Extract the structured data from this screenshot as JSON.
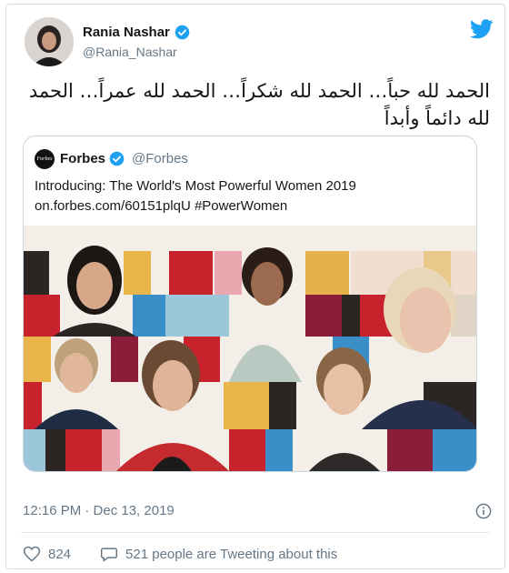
{
  "author": {
    "name": "Rania Nashar",
    "handle": "@Rania_Nashar"
  },
  "tweet": {
    "text": "الحمد لله حباً… الحمد لله شكراً… الحمد لله عمراً… الحمد لله دائماً وأبداً",
    "timestamp": "12:16 PM · Dec 13, 2019",
    "likes": "824",
    "replies_text": "521 people are Tweeting about this"
  },
  "quoted": {
    "logo_text": "Forbes",
    "name": "Forbes",
    "handle": "@Forbes",
    "line1": "Introducing: The World's Most Powerful Women 2019",
    "line2": "on.forbes.com/60151plqU #PowerWomen"
  },
  "colors": {
    "twitter_blue": "#1da1f2",
    "muted_text": "#657786",
    "verified_blue": "#1da1f2"
  },
  "icons": [
    "twitter-bird-icon",
    "verified-badge-icon",
    "info-icon",
    "heart-icon",
    "speech-bubble-icon"
  ]
}
